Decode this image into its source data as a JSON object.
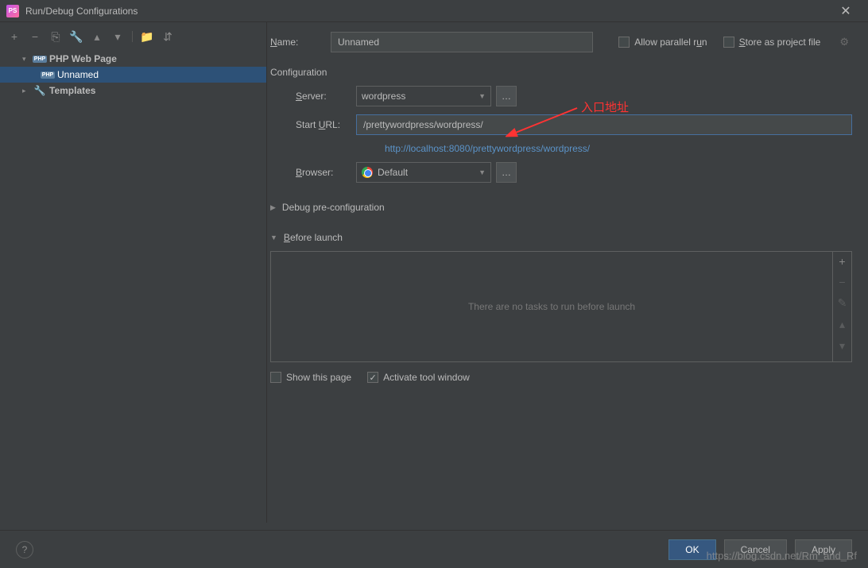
{
  "titlebar": {
    "title": "Run/Debug Configurations"
  },
  "tree": {
    "php_web_page": "PHP Web Page",
    "unnamed": "Unnamed",
    "templates": "Templates"
  },
  "form": {
    "name_label": "Name:",
    "name_value": "Unnamed",
    "allow_parallel": "Allow parallel run",
    "store_project": "Store as project file"
  },
  "config": {
    "section": "Configuration",
    "server_label": "Server:",
    "server_value": "wordpress",
    "url_label": "Start URL:",
    "url_value": "/prettywordpress/wordpress/",
    "url_resolved": "http://localhost:8080/prettywordpress/wordpress/",
    "browser_label": "Browser:",
    "browser_value": "Default"
  },
  "sections": {
    "debug_pre": "Debug pre-configuration",
    "before_launch": "Before launch",
    "tasks_empty": "There are no tasks to run before launch",
    "show_page": "Show this page",
    "activate_tool": "Activate tool window"
  },
  "footer": {
    "ok": "OK",
    "cancel": "Cancel",
    "apply": "Apply"
  },
  "annotation": "入口地址",
  "watermark": "https://blog.csdn.net/Rm_and_Rf"
}
